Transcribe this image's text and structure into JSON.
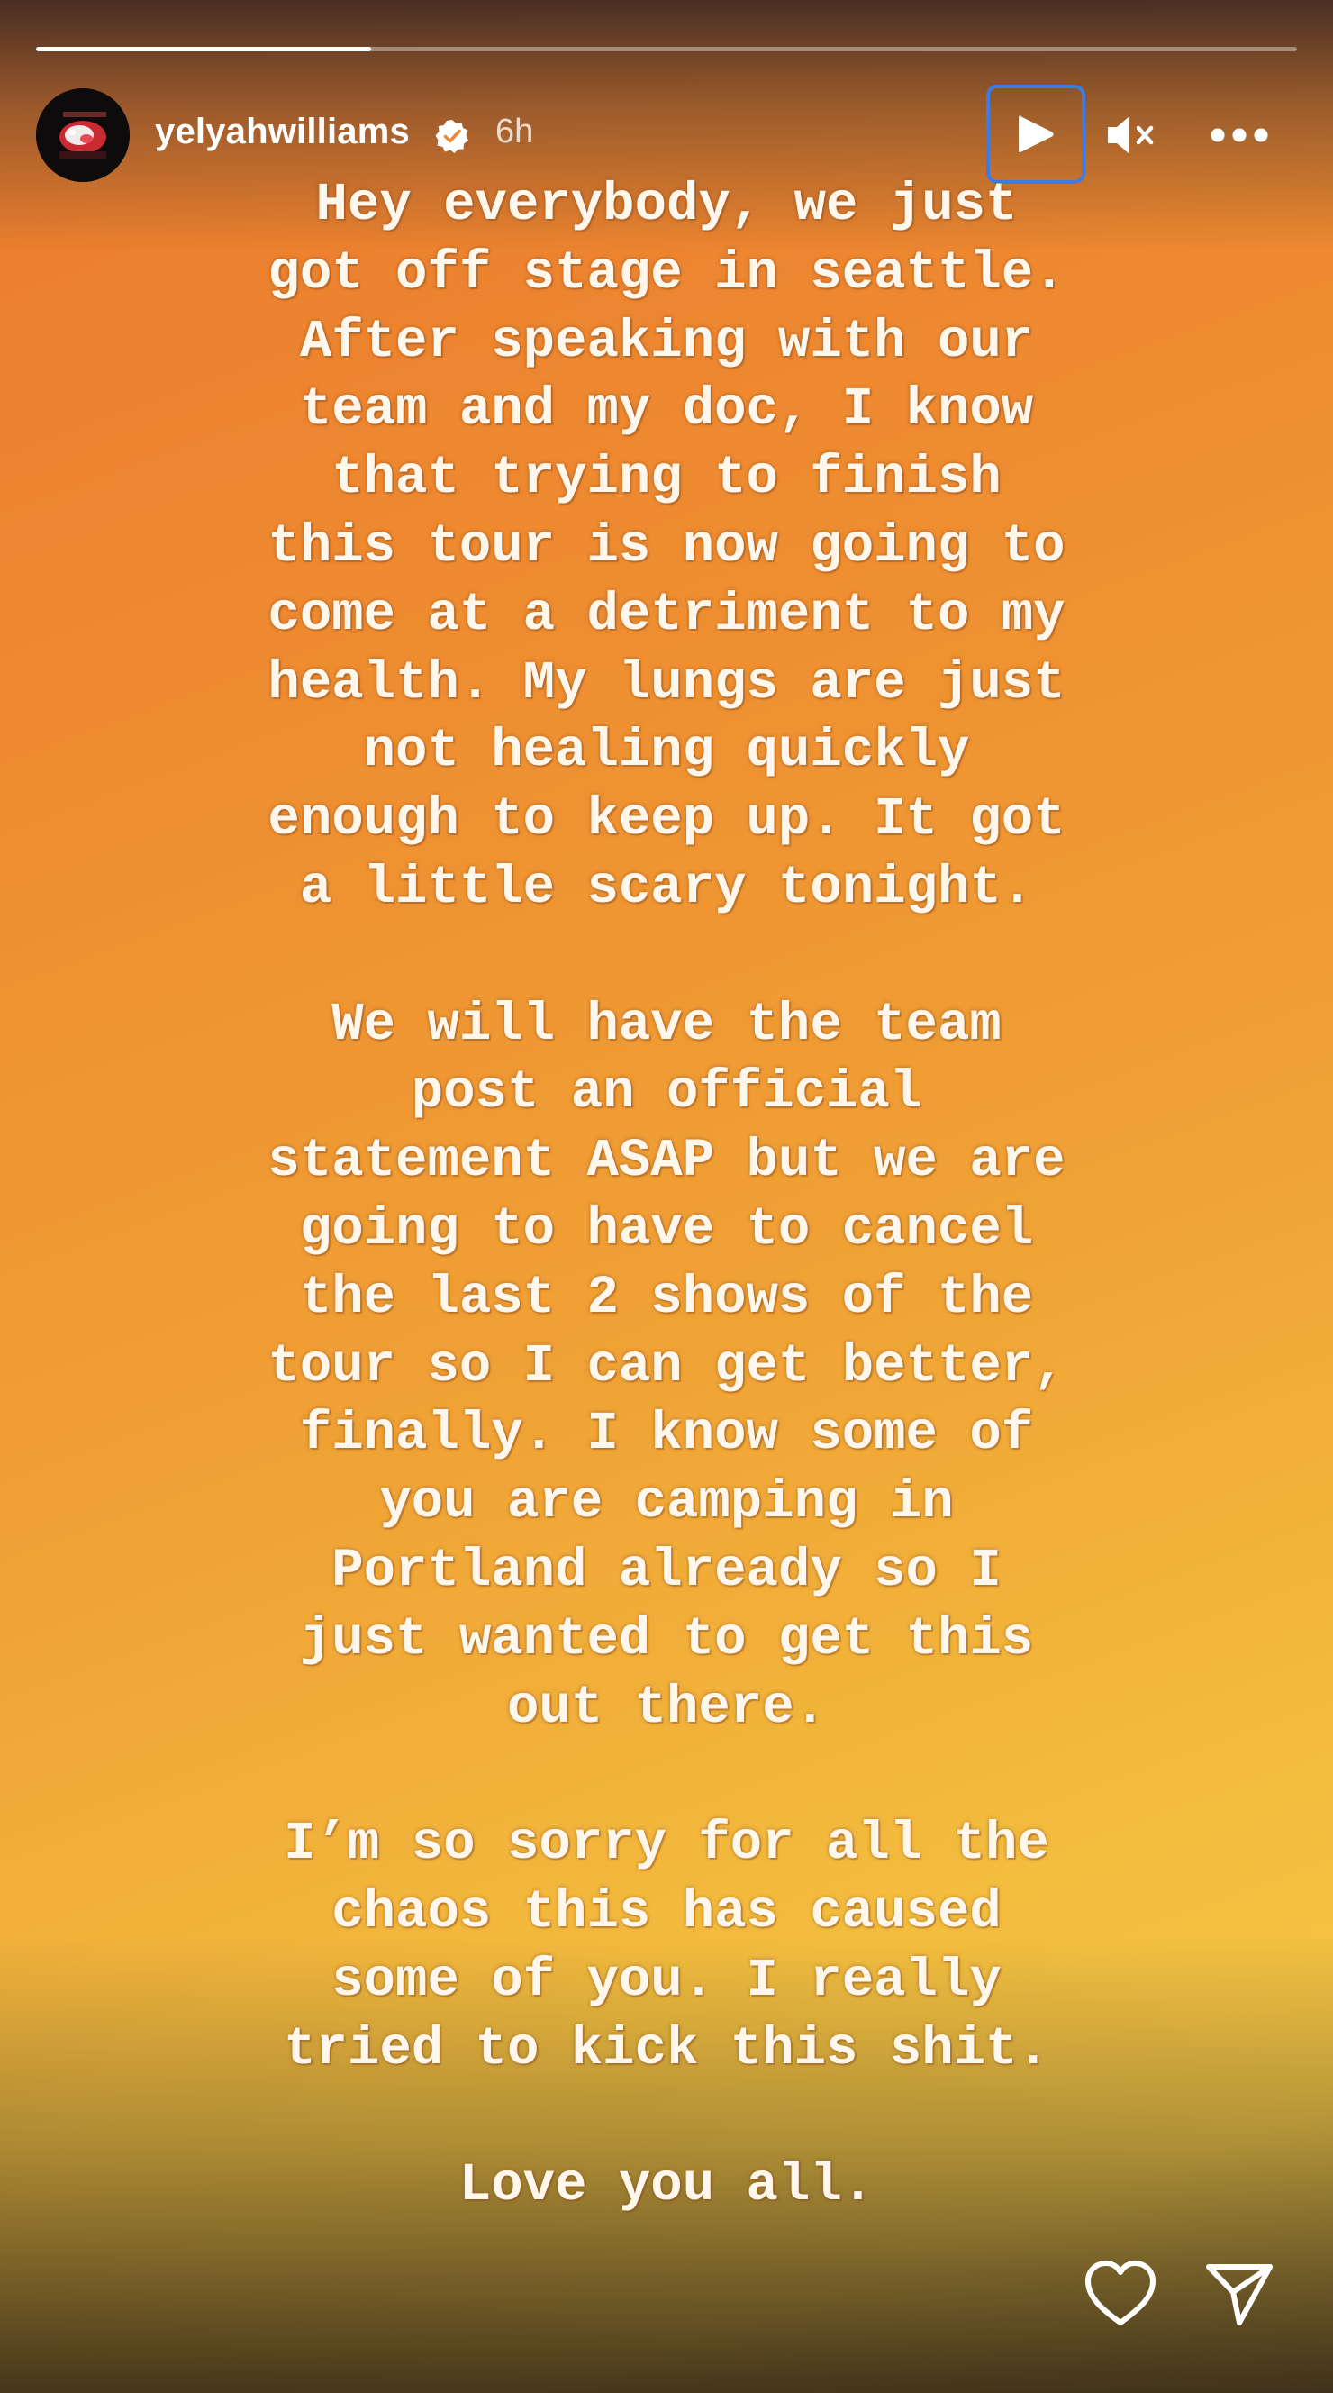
{
  "progress": {
    "fraction": 0.266
  },
  "header": {
    "username": "yelyahwilliams",
    "time_ago": "6h",
    "verified": true,
    "avatar_icon": "profile-photo",
    "play_icon": "play-icon",
    "mute_icon": "speaker-muted-icon",
    "more_icon": "more-horizontal-icon"
  },
  "story": {
    "lines": [
      "Hey everybody, we just",
      "got off stage in seattle.",
      "After speaking with our",
      "team and my doc, I know",
      "that trying to finish",
      "this tour is now going to",
      "come at a detriment to my",
      "health. My lungs are just",
      "not healing quickly",
      "enough to keep up. It got",
      "a little scary tonight.",
      "",
      "We will have the team",
      "post an official",
      "statement ASAP but we are",
      "going to have to cancel",
      "the last 2 shows of the",
      "tour so I can get better,",
      "finally. I know some of",
      "you are camping in",
      "Portland already so I",
      "just wanted to get this",
      "out there.",
      "",
      "I’m so sorry for all the",
      "chaos this has caused",
      "some of you. I really",
      "tried to kick this shit.",
      "",
      "Love you all."
    ]
  },
  "footer": {
    "like_icon": "heart-icon",
    "share_icon": "send-icon"
  },
  "colors": {
    "progress_track": "#ffffff61",
    "accent_focus": "#3d7be6",
    "text": "#fff6ec",
    "gradient_top": "#ea7a2e",
    "gradient_bottom": "#f4c544"
  }
}
